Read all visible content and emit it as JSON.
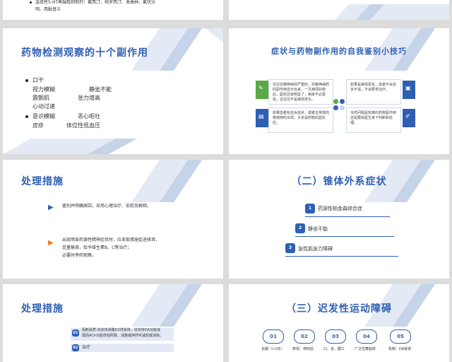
{
  "slide1": {
    "text_line1": "选择性5-HT再摄取抑制剂：氟西汀、帕罗西汀、舍曲林、氟伏沙",
    "text_line2": "明、西酞普兰"
  },
  "slide3": {
    "title": "药物检测观察的十个副作用",
    "groups": [
      {
        "label": "口干",
        "items": [
          "视力模糊",
          "静坐不能",
          "震颤肌",
          "张力增高",
          "心动过速"
        ]
      },
      {
        "label": "意识模糊",
        "items": [
          "恶心呕吐",
          "皮疹",
          "体位性低血压"
        ]
      }
    ]
  },
  "slide4": {
    "title": "症状与药物副作用的自我鉴别小技巧",
    "card_tl": "往往在精神病情严重时，抗精神病药的副作用显示出来，一旦病情好转后，副反应就明显了，病家不必紧张，这往往不是病情变化。",
    "card_tr": "如果是病情恶化，患者不会自诉不适，不会要求治疗。",
    "card_bl": "如果患者有自诉症状，或者在常规药物使用时出现，大多是药物的副反应。",
    "card_br": "当然问题是较难的药物副作用还是要由医生来下判断和处理。"
  },
  "slide5": {
    "title": "处理措施",
    "line1": "鉴别并明确原因，采用心理治疗、安慰及解释。",
    "line2": "出现明显药源性精神症状时，应采取措施促进排泄，",
    "line3": "足量输液，给予维生素B、C等治疗；",
    "line4": "必要时停药观察。"
  },
  "slide6": {
    "title": "（二）锥体外系症状",
    "items": [
      {
        "num": "1",
        "label": "药源性帕金森综合症"
      },
      {
        "num": "2",
        "label": "静坐不能"
      },
      {
        "num": "3",
        "label": "急性肌张力障碍"
      }
    ]
  },
  "slide7": {
    "title": "处理措施",
    "item1_num": "01",
    "item1_line1": "阻断黑质-纹状体通路D2样受体，纹状体DA功能减",
    "item1_line2": "弱而ACh功能增强所致，减量或停药可减轻或消除。",
    "item2_num": "02",
    "item2_label": "治疗"
  },
  "slide8": {
    "title": "（三）迟发性运动障碍",
    "steps": [
      {
        "num": "01",
        "caption": "长期（>1年）"
      },
      {
        "num": "02",
        "caption": "表现：停药后"
      },
      {
        "num": "03",
        "caption": "口、舌、腮三"
      },
      {
        "num": "04",
        "caption": "广泛性舞蹈样"
      },
      {
        "num": "05",
        "caption": "机制：DA受体"
      }
    ]
  },
  "colors": {
    "accent": "#2f5fb4",
    "green": "#5aa846",
    "light_blue": "#c6d4ea"
  }
}
